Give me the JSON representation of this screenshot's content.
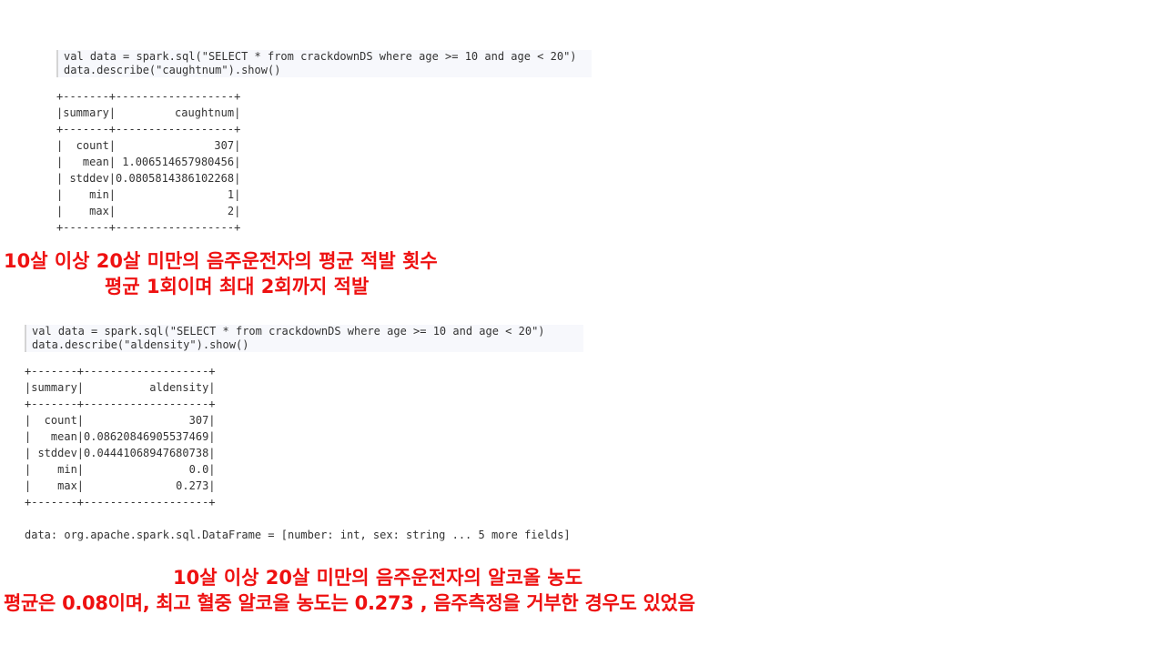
{
  "cell1": {
    "lines": [
      "val data = spark.sql(\"SELECT * from crackdownDS where age >= 10 and age < 20\")",
      "data.describe(\"caughtnum\").show()"
    ]
  },
  "output1": {
    "rows": [
      "+-------+------------------+",
      "|summary|         caughtnum|",
      "+-------+------------------+",
      "|  count|               307|",
      "|   mean| 1.006514657980456|",
      "| stddev|0.0805814386102268|",
      "|    min|                 1|",
      "|    max|                 2|",
      "+-------+------------------+"
    ]
  },
  "note1": {
    "line1": "10살 이상 20살 미만의 음주운전자의 평균 적발 횟수",
    "line2": "평균 1회이며 최대 2회까지 적발"
  },
  "cell2": {
    "lines": [
      "val data = spark.sql(\"SELECT * from crackdownDS where age >= 10 and age < 20\")",
      "data.describe(\"aldensity\").show()"
    ]
  },
  "output2": {
    "rows": [
      "+-------+-------------------+",
      "|summary|          aldensity|",
      "+-------+-------------------+",
      "|  count|                307|",
      "|   mean|0.08620846905537469|",
      "| stddev|0.04441068947680738|",
      "|    min|                0.0|",
      "|    max|              0.273|",
      "+-------+-------------------+",
      "",
      "data: org.apache.spark.sql.DataFrame = [number: int, sex: string ... 5 more fields]"
    ]
  },
  "note2": {
    "line1": "10살 이상 20살 미만의 음주운전자의 알코올 농도",
    "line2": "평균은 0.08이며, 최고 혈중 알코올 농도는 0.273 , 음주측정을 거부한 경우도 있었음"
  },
  "colors": {
    "annotation": "#ee1111",
    "cell_background": "#f7f8fc",
    "cell_border": "#d4d4d4",
    "code_text": "#333333"
  }
}
